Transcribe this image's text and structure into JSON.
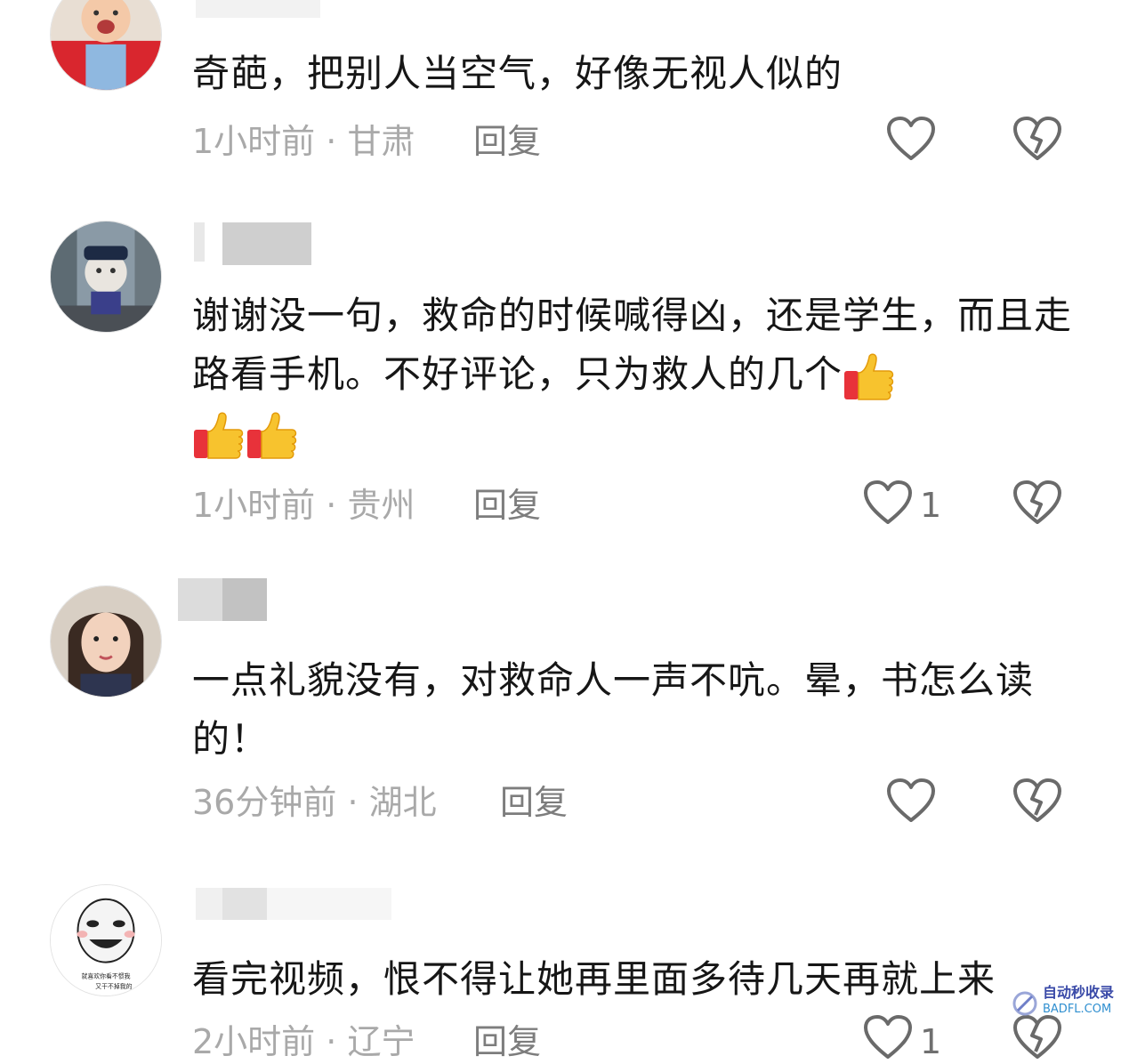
{
  "comments": [
    {
      "text": "奇葩，把别人当空气，好像无视人似的",
      "time": "1小时前",
      "location": "甘肃",
      "reply": "回复",
      "likes": ""
    },
    {
      "text": "谢谢没一句，救命的时候喊得凶，还是学生，而且走路看手机。不好评论，只为救人的几个",
      "time": "1小时前",
      "location": "贵州",
      "reply": "回复",
      "likes": "1"
    },
    {
      "text": "一点礼貌没有，对救命人一声不吭。晕，书怎么读的！",
      "time": "36分钟前",
      "location": "湖北",
      "reply": "回复",
      "likes": ""
    },
    {
      "text": "看完视频，恨不得让她再里面多待几天再就上来",
      "time": "2小时前",
      "location": "辽宁",
      "reply": "回复",
      "likes": "1"
    }
  ],
  "meta_separator": " · ",
  "icons": {
    "like": "heart-outline-icon",
    "dislike": "broken-heart-icon",
    "emoji": "thumbs-up-emoji"
  },
  "watermark": {
    "line1": "自动秒收录",
    "line2": "BADFL.COM"
  },
  "avatar_caption": {
    "line1": "就喜欢你看不惯我",
    "line2": "又干不掉我的"
  },
  "colors": {
    "text": "#161616",
    "meta": "#a9a9a9",
    "reply": "#7d7d7d",
    "icon": "#6a6a6a"
  }
}
